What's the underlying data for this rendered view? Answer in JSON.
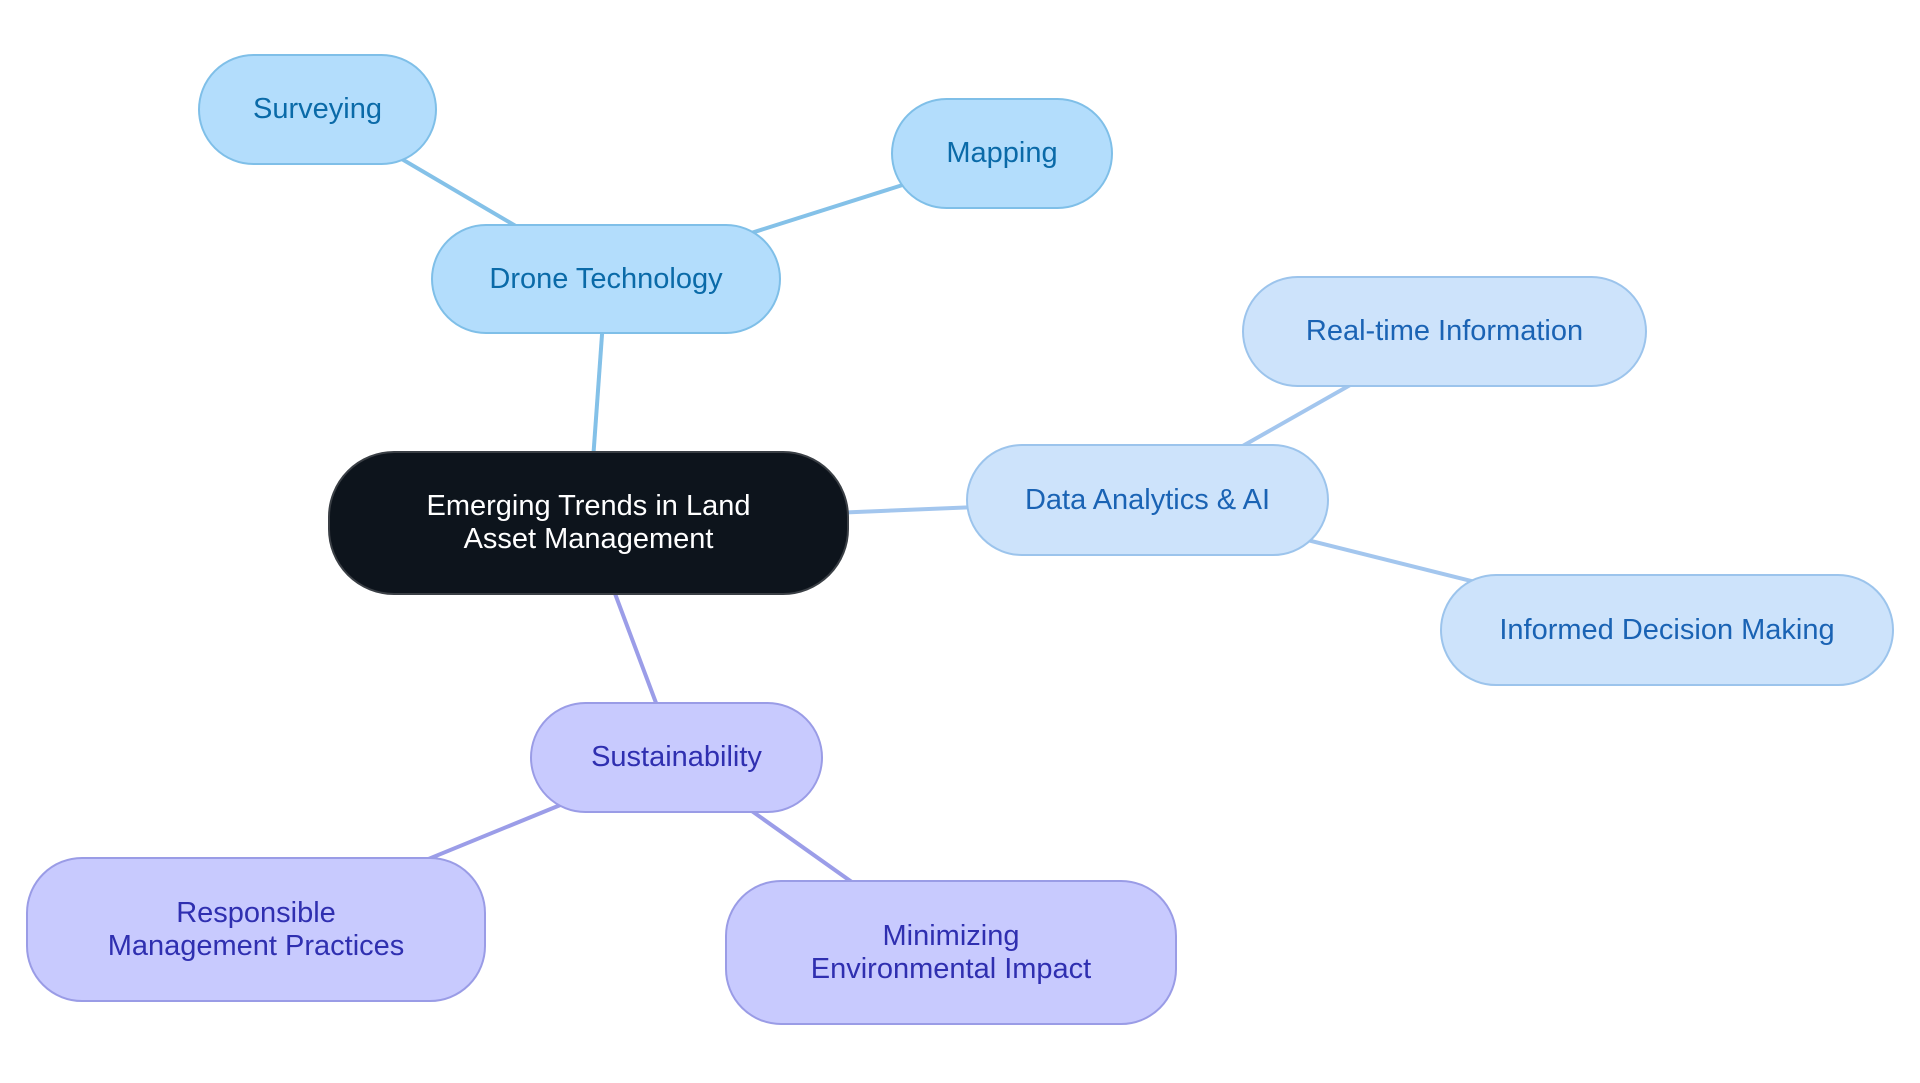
{
  "title": "Emerging Trends in Land Asset Management",
  "colors": {
    "root_fill": "#0d141c",
    "drone_branch": "#b3ddfc",
    "drone_edge": "#84c1e8",
    "data_branch": "#cde3fb",
    "data_edge": "#a3c6ee",
    "sustainability_branch": "#c8cafe",
    "sustainability_edge": "#9b9de8"
  },
  "nodes": {
    "root": {
      "label": "Emerging Trends in Land Asset Management"
    },
    "drone": {
      "label": "Drone Technology"
    },
    "surveying": {
      "label": "Surveying"
    },
    "mapping": {
      "label": "Mapping"
    },
    "data": {
      "label": "Data Analytics & AI"
    },
    "realtime": {
      "label": "Real-time Information"
    },
    "informed": {
      "label": "Informed Decision Making"
    },
    "sustainability": {
      "label": "Sustainability"
    },
    "responsible": {
      "label": "Responsible Management Practices"
    },
    "minimizing": {
      "label": "Minimizing Environmental Impact"
    }
  },
  "edges": [
    {
      "from": "root",
      "to": "drone",
      "color_key": "drone_edge"
    },
    {
      "from": "drone",
      "to": "surveying",
      "color_key": "drone_edge"
    },
    {
      "from": "drone",
      "to": "mapping",
      "color_key": "drone_edge"
    },
    {
      "from": "root",
      "to": "data",
      "color_key": "data_edge"
    },
    {
      "from": "data",
      "to": "realtime",
      "color_key": "data_edge"
    },
    {
      "from": "data",
      "to": "informed",
      "color_key": "data_edge"
    },
    {
      "from": "root",
      "to": "sustainability",
      "color_key": "sustainability_edge"
    },
    {
      "from": "sustainability",
      "to": "responsible",
      "color_key": "sustainability_edge"
    },
    {
      "from": "sustainability",
      "to": "minimizing",
      "color_key": "sustainability_edge"
    }
  ]
}
